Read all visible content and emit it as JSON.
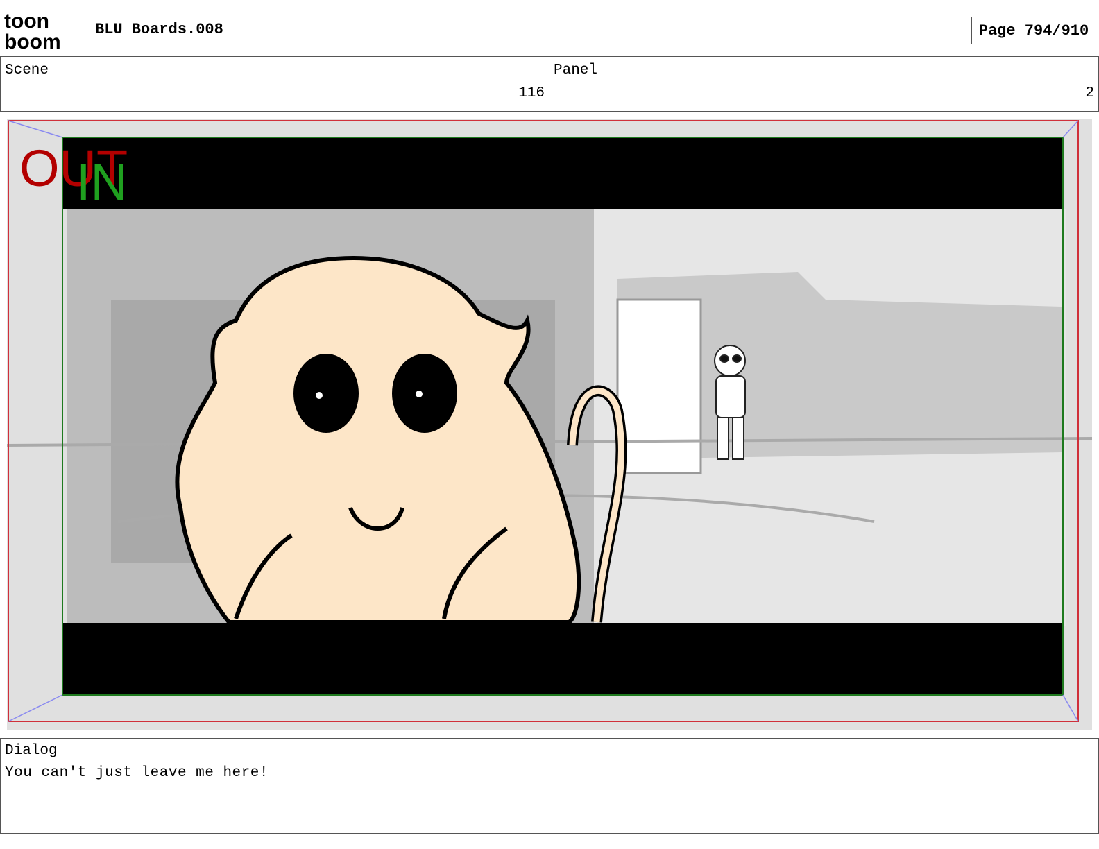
{
  "header": {
    "logo_text_line1": "toon",
    "logo_text_line2": "boom",
    "title": "BLU Boards.008",
    "page_indicator": "Page 794/910"
  },
  "scene": {
    "label": "Scene",
    "value": "116"
  },
  "panel": {
    "label": "Panel",
    "value": "2"
  },
  "frame": {
    "out_label": "OUT",
    "in_label": "IN",
    "colors": {
      "out_label": "#b30000",
      "in_label": "#1fa01f",
      "outer_border": "#d0303a",
      "safe_border": "#1f7a1f",
      "letterbox": "#000000",
      "background": "#e0e0e0",
      "creature_fill": "#fde6c8"
    }
  },
  "dialog": {
    "label": "Dialog",
    "text": "You can't just leave me here!"
  }
}
